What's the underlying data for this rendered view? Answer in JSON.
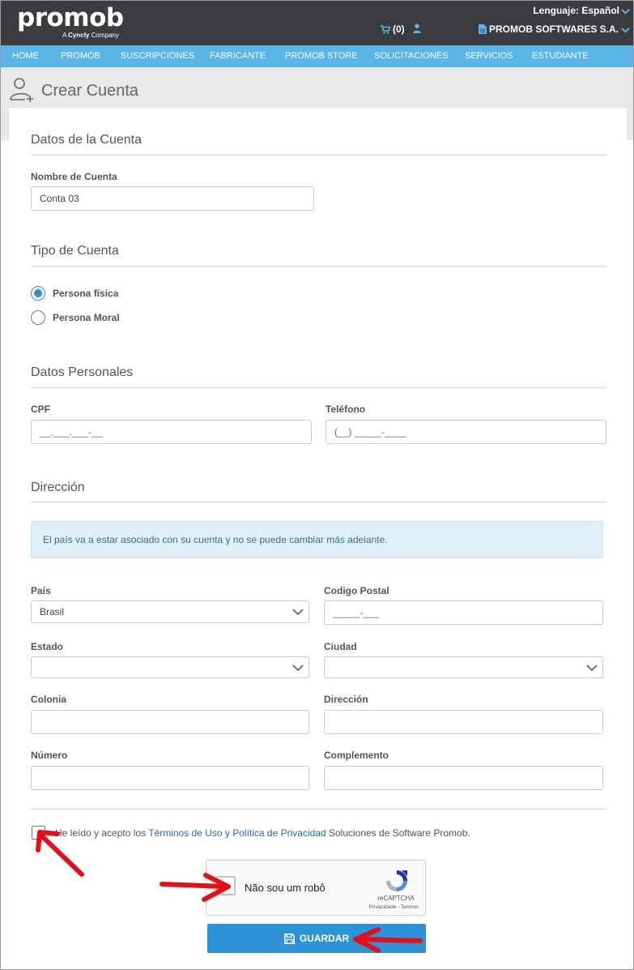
{
  "header": {
    "logo": "promob",
    "logo_sub_prefix": "A",
    "logo_sub_brand": "Cyncly",
    "logo_sub_suffix": "Company",
    "language": "Lenguaje: Español",
    "cart_count": "(0)",
    "company": "PROMOB SOFTWARES S.A."
  },
  "nav": {
    "items": [
      "HOME",
      "PROMOB",
      "SUSCRIPCIONES",
      "FABRICANTE",
      "PROMOB STORE",
      "SOLICITACIONES",
      "SERVICIOS",
      "ESTUDIANTE"
    ]
  },
  "page": {
    "title": "Crear Cuenta"
  },
  "account": {
    "section": "Datos de la Cuenta",
    "name_label": "Nombre de Cuenta",
    "name_value": "Conta 03"
  },
  "account_type": {
    "section": "Tipo de Cuenta",
    "options": [
      "Persona física",
      "Persona Moral"
    ],
    "selected": "Persona física"
  },
  "personal": {
    "section": "Datos Personales",
    "cpf_label": "CPF",
    "cpf_mask": "__.___.___-__",
    "phone_label": "Teléfono",
    "phone_mask": "(__) _____-____"
  },
  "address": {
    "section": "Dirección",
    "info": "El país va a estar asociado con su cuenta y no se puede cambiar más adelante.",
    "country_label": "País",
    "country_value": "Brasil",
    "zip_label": "Codigo Postal",
    "zip_mask": "_____-___",
    "state_label": "Estado",
    "city_label": "Ciudad",
    "colonia_label": "Colonia",
    "street_label": "Dirección",
    "number_label": "Número",
    "complement_label": "Complemento"
  },
  "terms": {
    "prefix": "He leído y acepto los ",
    "terms_link": "Términos de Uso",
    "and": " y ",
    "privacy_link": "Política de Privacidad",
    "suffix": " Soluciones de Software Promob."
  },
  "captcha": {
    "label": "Não sou um robô",
    "brand": "reCAPTCHA",
    "links": "Privacidade - Termos"
  },
  "actions": {
    "save": "GUARDAR"
  },
  "colors": {
    "header_bg": "#3b3c3f",
    "nav_bg": "#5ab4e7",
    "primary": "#2d92d6",
    "annotation_arrow": "#e3101a"
  }
}
